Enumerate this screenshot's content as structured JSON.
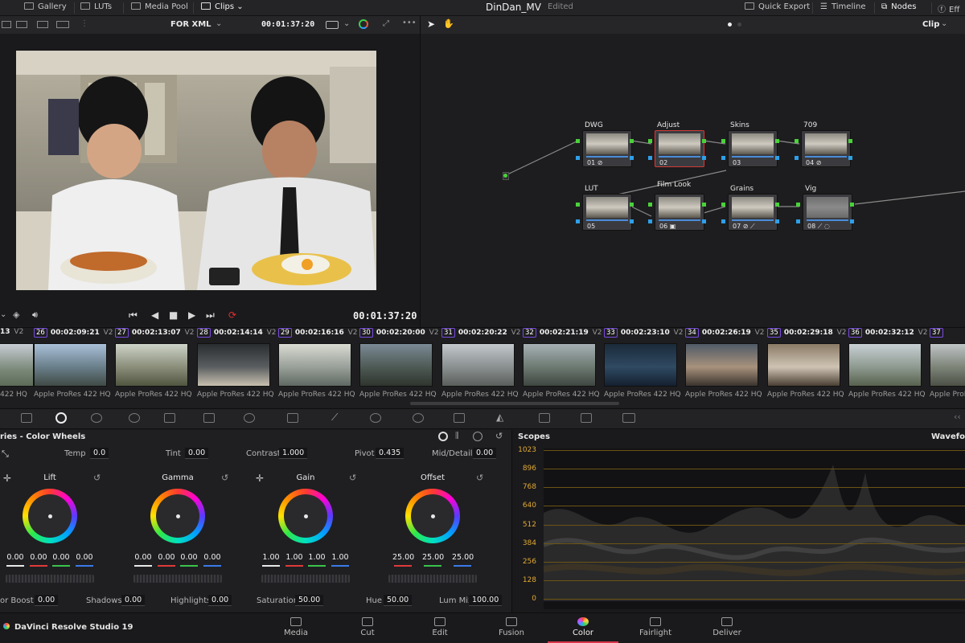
{
  "topbar": {
    "gallery": "Gallery",
    "luts": "LUTs",
    "media_pool": "Media Pool",
    "clips": "Clips",
    "project": "DinDan_MV",
    "status": "Edited",
    "quick_export": "Quick Export",
    "timeline": "Timeline",
    "nodes": "Nodes",
    "effects": "Eff"
  },
  "viewer": {
    "timeline_name": "FOR XML",
    "timecode_top": "00:01:37:20",
    "timecode_bottom": "00:01:37:20"
  },
  "node_editor": {
    "mode": "Clip",
    "nodes": [
      {
        "label": "DWG",
        "num": "01"
      },
      {
        "label": "Adjust",
        "num": "02"
      },
      {
        "label": "Skins",
        "num": "03"
      },
      {
        "label": "709",
        "num": "04"
      },
      {
        "label": "LUT",
        "num": "05"
      },
      {
        "label": "Film Look",
        "num": "06"
      },
      {
        "label": "Grains",
        "num": "07"
      },
      {
        "label": "Vig",
        "num": "08"
      }
    ]
  },
  "clips": {
    "first_partial_tc": "13",
    "first_partial_codec": "422 HQ",
    "items": [
      {
        "num": "26",
        "tc": "00:02:09:21",
        "track": "V2",
        "codec": "Apple ProRes 422 HQ"
      },
      {
        "num": "27",
        "tc": "00:02:13:07",
        "track": "V2",
        "codec": "Apple ProRes 422 HQ"
      },
      {
        "num": "28",
        "tc": "00:02:14:14",
        "track": "V2",
        "codec": "Apple ProRes 422 HQ"
      },
      {
        "num": "29",
        "tc": "00:02:16:16",
        "track": "V2",
        "codec": "Apple ProRes 422 HQ"
      },
      {
        "num": "30",
        "tc": "00:02:20:00",
        "track": "V2",
        "codec": "Apple ProRes 422 HQ"
      },
      {
        "num": "31",
        "tc": "00:02:20:22",
        "track": "V2",
        "codec": "Apple ProRes 422 HQ"
      },
      {
        "num": "32",
        "tc": "00:02:21:19",
        "track": "V2",
        "codec": "Apple ProRes 422 HQ"
      },
      {
        "num": "33",
        "tc": "00:02:23:10",
        "track": "V2",
        "codec": "Apple ProRes 422 HQ"
      },
      {
        "num": "34",
        "tc": "00:02:26:19",
        "track": "V2",
        "codec": "Apple ProRes 422 HQ"
      },
      {
        "num": "35",
        "tc": "00:02:29:18",
        "track": "V2",
        "codec": "Apple ProRes 422 HQ"
      },
      {
        "num": "36",
        "tc": "00:02:32:12",
        "track": "V2",
        "codec": "Apple ProRes 422 HQ"
      },
      {
        "num": "37",
        "tc": "",
        "track": "",
        "codec": "Apple ProR"
      }
    ]
  },
  "color_wheels": {
    "title": "ries - Color Wheels",
    "params_top": [
      {
        "label": "Temp",
        "value": "0.0"
      },
      {
        "label": "Tint",
        "value": "0.00"
      },
      {
        "label": "Contrast",
        "value": "1.000"
      },
      {
        "label": "Pivot",
        "value": "0.435"
      },
      {
        "label": "Mid/Detail",
        "value": "0.00"
      }
    ],
    "wheels": [
      {
        "name": "Lift",
        "values": [
          "0.00",
          "0.00",
          "0.00",
          "0.00"
        ]
      },
      {
        "name": "Gamma",
        "values": [
          "0.00",
          "0.00",
          "0.00",
          "0.00"
        ]
      },
      {
        "name": "Gain",
        "values": [
          "1.00",
          "1.00",
          "1.00",
          "1.00"
        ]
      },
      {
        "name": "Offset",
        "values": [
          "25.00",
          "25.00",
          "25.00"
        ]
      }
    ],
    "params_bottom": [
      {
        "label": "or Boost",
        "value": "0.00"
      },
      {
        "label": "Shadows",
        "value": "0.00"
      },
      {
        "label": "Highlights",
        "value": "0.00"
      },
      {
        "label": "Saturation",
        "value": "50.00"
      },
      {
        "label": "Hue",
        "value": "50.00"
      },
      {
        "label": "Lum Mix",
        "value": "100.00"
      }
    ]
  },
  "scopes": {
    "title": "Scopes",
    "mode": "Wavefor",
    "scale": [
      "1023",
      "896",
      "768",
      "640",
      "512",
      "384",
      "256",
      "128",
      "0"
    ]
  },
  "app": {
    "name": "DaVinci Resolve Studio 19"
  },
  "pages": [
    {
      "label": "Media",
      "active": false
    },
    {
      "label": "Cut",
      "active": false
    },
    {
      "label": "Edit",
      "active": false
    },
    {
      "label": "Fusion",
      "active": false
    },
    {
      "label": "Color",
      "active": true
    },
    {
      "label": "Fairlight",
      "active": false
    },
    {
      "label": "Deliver",
      "active": false
    }
  ],
  "colors": {
    "accent_red": "#d8364a",
    "node_port_green": "#4bd13b",
    "node_port_blue": "#2f9fe8",
    "clip_number_border": "#7a4be0",
    "scope_scale": "#e0a832"
  }
}
